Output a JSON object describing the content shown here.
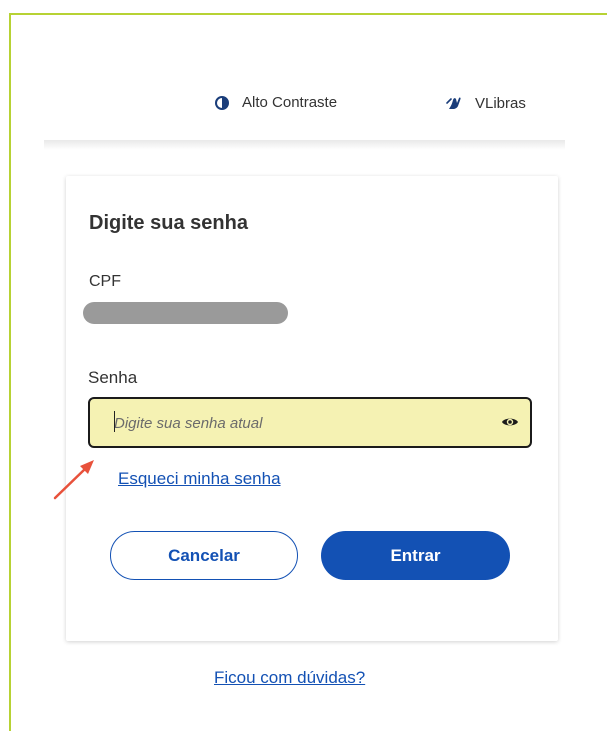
{
  "header": {
    "contrast_label": "Alto Contraste",
    "vlibras_label": "VLibras"
  },
  "login": {
    "title": "Digite sua senha",
    "cpf_label": "CPF",
    "password_label": "Senha",
    "password_placeholder": "Digite sua senha atual",
    "password_value": "",
    "forgot_link": "Esqueci minha senha",
    "cancel_label": "Cancelar",
    "enter_label": "Entrar"
  },
  "footer": {
    "help_link": "Ficou com dúvidas?"
  },
  "colors": {
    "primary": "#1351b4",
    "field_highlight": "#f5f2b3",
    "frame_border": "#b7d234",
    "annotation_arrow": "#e8513b"
  },
  "icons": {
    "contrast": "contrast-icon",
    "vlibras": "sign-language-hand-icon",
    "password_toggle": "eye-icon"
  }
}
